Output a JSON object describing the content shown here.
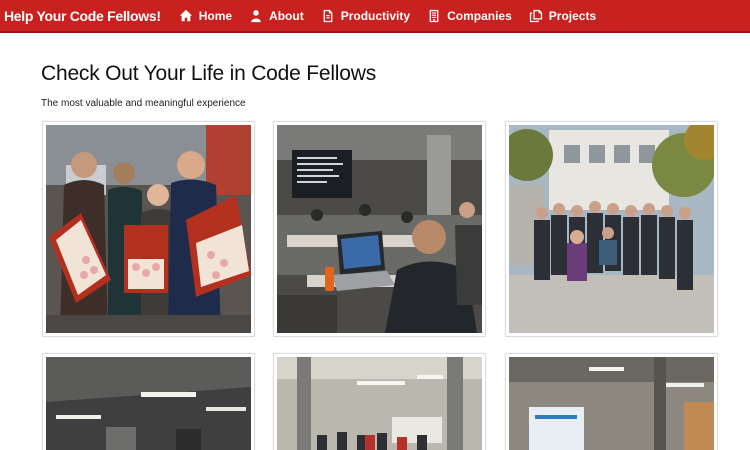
{
  "navbar": {
    "brand": "Help Your Code Fellows!",
    "items": [
      {
        "label": "Home",
        "icon": "home-icon"
      },
      {
        "label": "About",
        "icon": "user-icon"
      },
      {
        "label": "Productivity",
        "icon": "document-icon"
      },
      {
        "label": "Companies",
        "icon": "building-icon"
      },
      {
        "label": "Projects",
        "icon": "copy-icon"
      }
    ]
  },
  "page": {
    "title": "Check Out Your Life in Code Fellows",
    "subtitle": "The most valuable and meaningful experience"
  },
  "colors": {
    "navbar": "#c8211f",
    "background": "#ffffff"
  }
}
